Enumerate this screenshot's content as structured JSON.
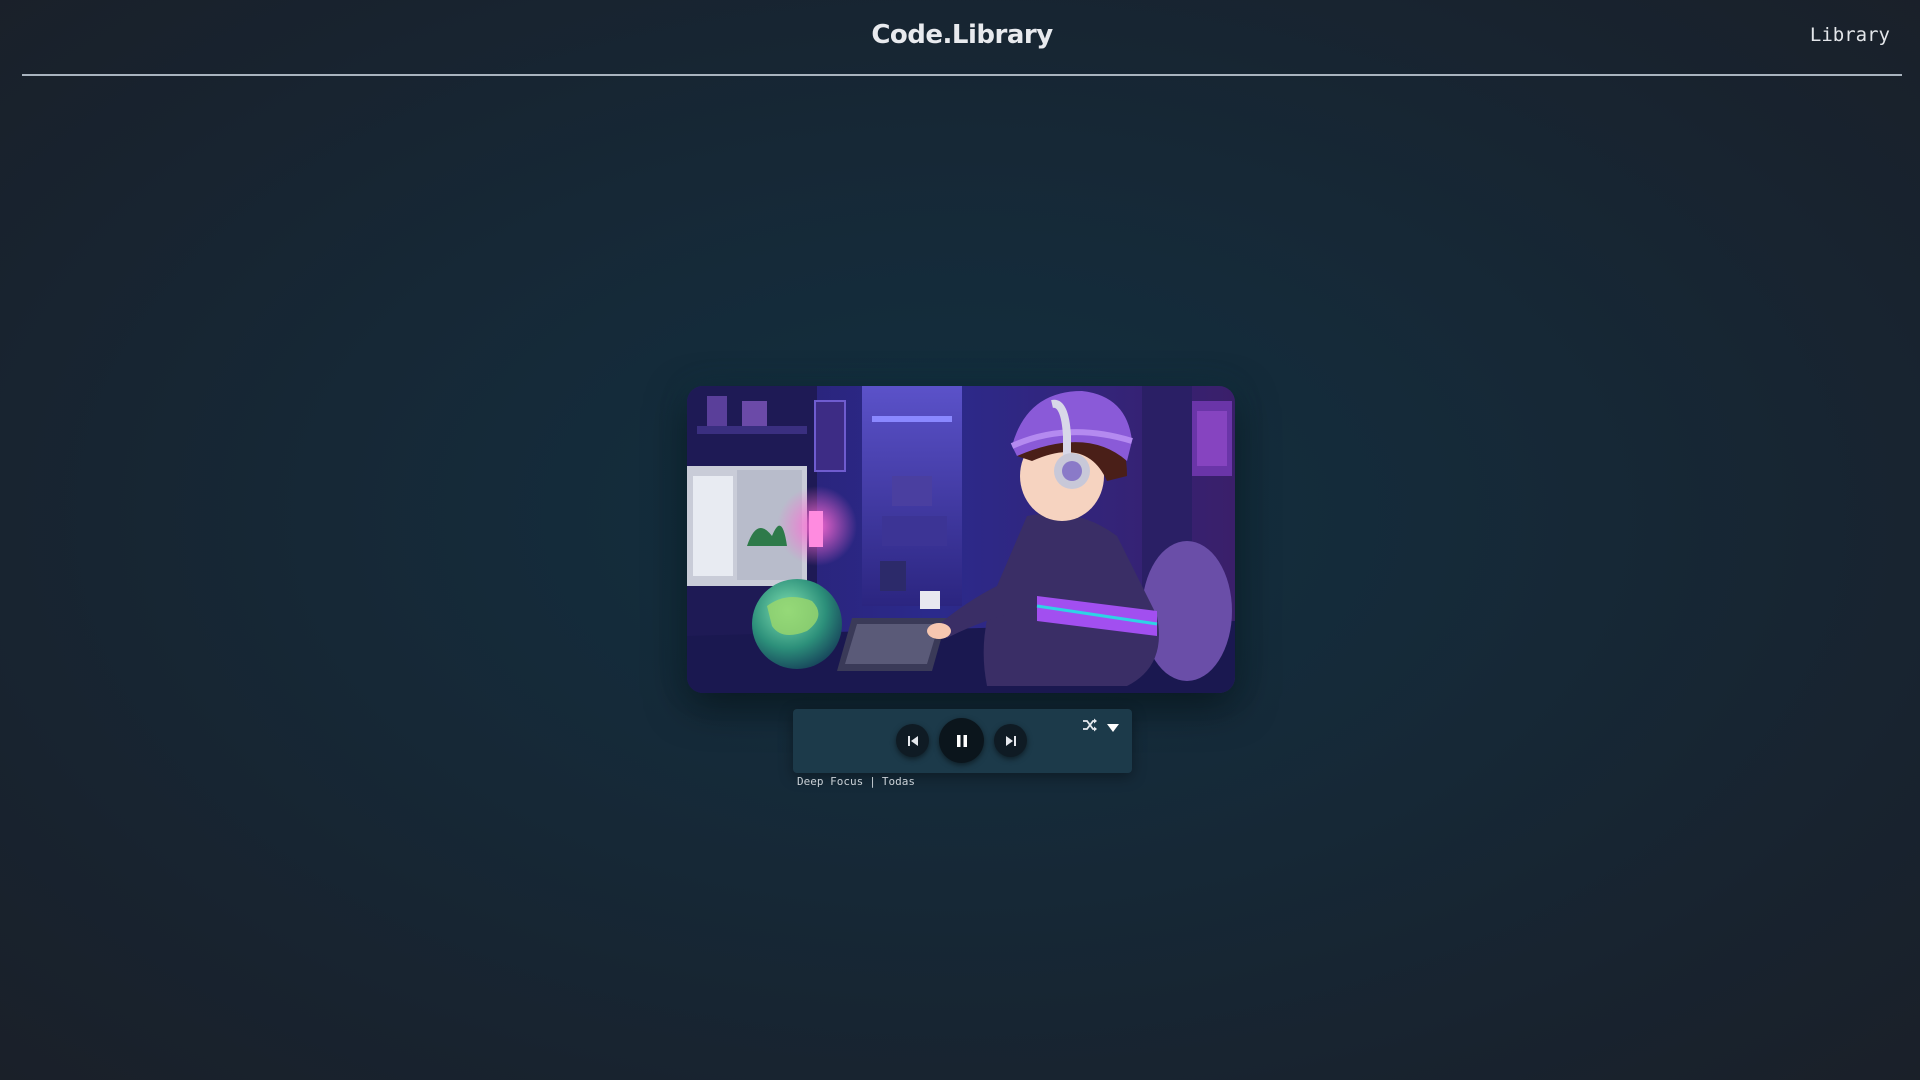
{
  "header": {
    "brand": "Code.Library",
    "nav_link": "Library"
  },
  "player": {
    "artwork_alt": "lofi study illustration",
    "controls": {
      "previous_icon": "skip-previous-icon",
      "play_pause_icon": "pause-icon",
      "next_icon": "skip-next-icon",
      "shuffle_icon": "shuffle-icon",
      "dropdown_icon": "chevron-down-icon"
    },
    "now_playing": {
      "playlist": "Deep Focus",
      "separator": "|",
      "filter": "Todas"
    }
  },
  "colors": {
    "background": "#172733",
    "header_rule": "#a9b4bf",
    "control_bar": "#1c3a4a",
    "button": "#0f1b24"
  }
}
